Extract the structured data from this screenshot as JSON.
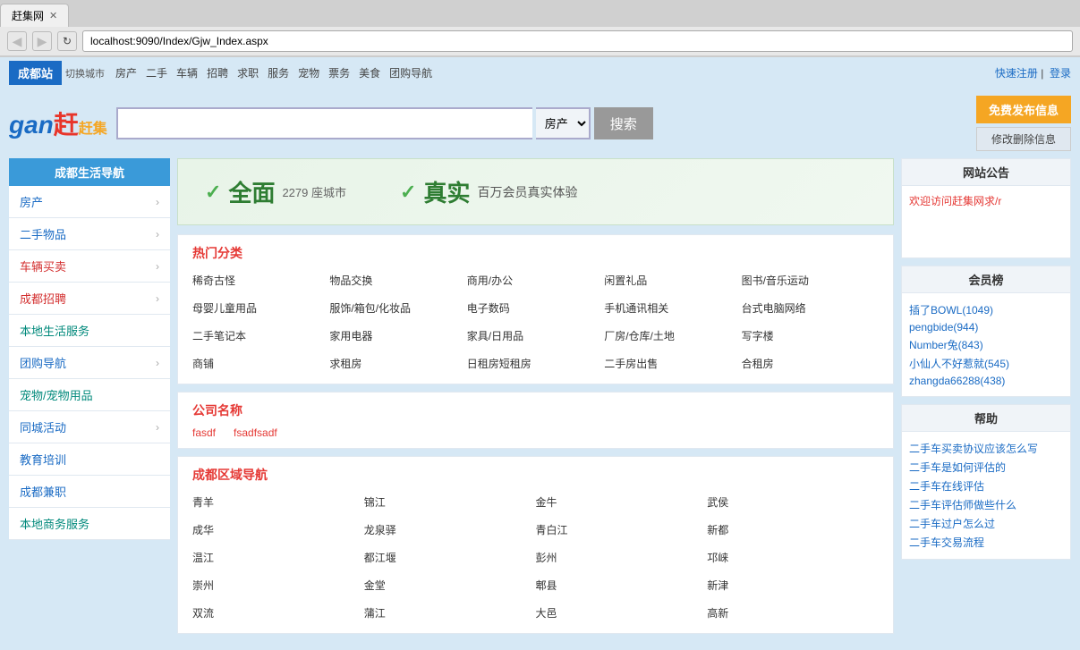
{
  "browser": {
    "tab_title": "赶集网",
    "url": "localhost:9090/Index/Gjw_Index.aspx"
  },
  "topnav": {
    "city": "成都站",
    "switch_city": "切换城市",
    "links": [
      "房产",
      "二手",
      "车辆",
      "招聘",
      "求职",
      "服务",
      "宠物",
      "票务",
      "美食",
      "团购导航"
    ],
    "right_register": "快速注册",
    "right_login": "登录"
  },
  "header": {
    "logo_gan": "gan",
    "logo_ji_icon": "赶",
    "logo_text": "赶集",
    "search_placeholder": "",
    "search_category": "房产",
    "search_button": "搜索",
    "publish_btn": "免费发布信息",
    "modify_btn": "修改删除信息"
  },
  "sidebar": {
    "title": "成都生活导航",
    "items": [
      {
        "label": "房产",
        "style": "blue"
      },
      {
        "label": "二手物品",
        "style": "blue"
      },
      {
        "label": "车辆买卖",
        "style": "red"
      },
      {
        "label": "成都招聘",
        "style": "red"
      },
      {
        "label": "本地生活服务",
        "style": "teal"
      },
      {
        "label": "团购导航",
        "style": "blue"
      },
      {
        "label": "宠物/宠物用品",
        "style": "teal"
      },
      {
        "label": "同城活动",
        "style": "blue"
      },
      {
        "label": "教育培训",
        "style": "blue"
      },
      {
        "label": "成都兼职",
        "style": "blue"
      },
      {
        "label": "本地商务服务",
        "style": "teal"
      }
    ]
  },
  "banner": {
    "check1": "✓",
    "main1": "全面",
    "count1": "2279 座城市",
    "check2": "✓",
    "main2": "真实",
    "sub2": "百万会员真实体验"
  },
  "hot": {
    "title": "热门分类",
    "categories": [
      "稀奇古怪",
      "物品交换",
      "商用/办公",
      "闲置礼品",
      "图书/音乐运动",
      "母婴儿童用品",
      "服饰/箱包/化妆品",
      "电子数码",
      "手机通讯相关",
      "台式电脑网络",
      "二手笔记本",
      "家用电器",
      "家具/日用品",
      "厂房/仓库/土地",
      "写字楼",
      "商铺",
      "求租房",
      "日租房短租房",
      "二手房出售",
      "合租房"
    ]
  },
  "company": {
    "title": "公司名称",
    "items": [
      "fasdf",
      "fsadfsadf"
    ]
  },
  "area": {
    "title": "成都区域导航",
    "items": [
      "青羊",
      "锦江",
      "金牛",
      "武侯",
      "成华",
      "龙泉驿",
      "青白江",
      "新都",
      "温江",
      "都江堰",
      "彭州",
      "邛崃",
      "崇州",
      "金堂",
      "郫县",
      "新津",
      "双流",
      "蒲江",
      "大邑",
      "高新"
    ]
  },
  "right": {
    "notice_title": "网站公告",
    "notice_link": "欢迎访问赶集网求/r",
    "member_title": "会员榜",
    "members": [
      "插了BOWL(1049)",
      "pengbide(944)",
      "Number兔(843)",
      "小仙人不好惹就(545)",
      "zhangda66288(438)"
    ],
    "help_title": "帮助",
    "help_items": [
      "二手车买卖协议应该怎么写",
      "二手车是如何评估的",
      "二手车在线评估",
      "二手车评估师做些什么",
      "二手车过户怎么过",
      "二手车交易流程"
    ]
  }
}
